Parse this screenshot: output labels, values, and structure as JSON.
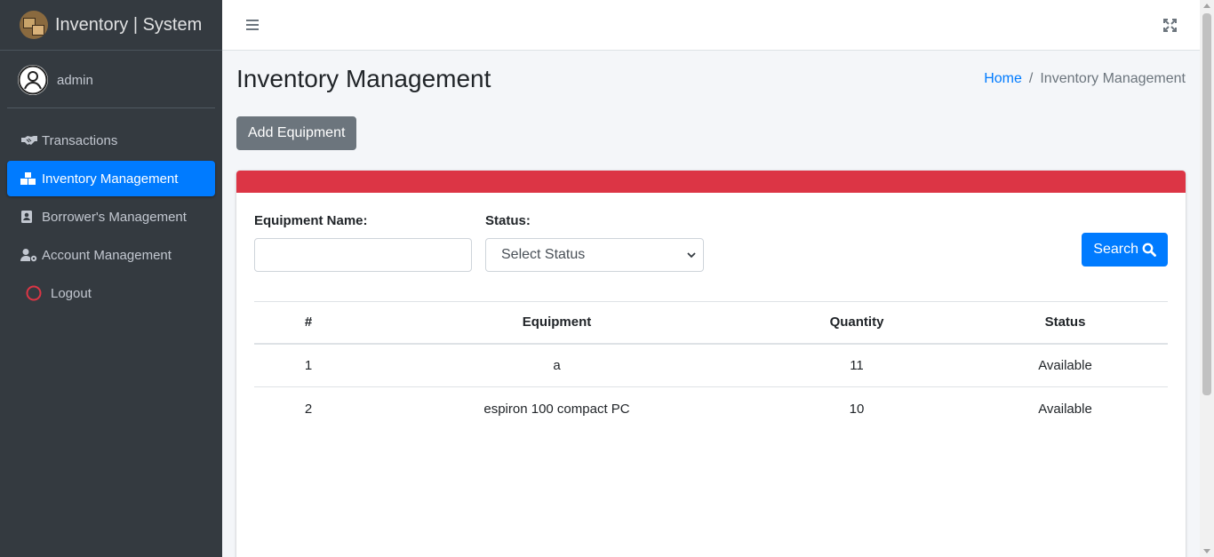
{
  "brand": {
    "title": "Inventory | System"
  },
  "user": {
    "name": "admin"
  },
  "sidebar": {
    "items": [
      {
        "label": "Transactions",
        "icon": "handshake-icon"
      },
      {
        "label": "Inventory Management",
        "icon": "boxes-icon",
        "active": true
      },
      {
        "label": "Borrower's Management",
        "icon": "address-book-icon"
      },
      {
        "label": "Account Management",
        "icon": "user-cog-icon"
      },
      {
        "label": "Logout",
        "icon": "logout-circle-icon"
      }
    ]
  },
  "page": {
    "title": "Inventory Management",
    "breadcrumb": {
      "home": "Home",
      "current": "Inventory Management"
    },
    "add_button": "Add Equipment"
  },
  "filters": {
    "name_label": "Equipment Name:",
    "name_value": "",
    "status_label": "Status:",
    "status_selected": "Select Status",
    "search_button": "Search"
  },
  "table": {
    "headers": [
      "#",
      "Equipment",
      "Quantity",
      "Status"
    ],
    "rows": [
      {
        "num": "1",
        "equipment": "a",
        "quantity": "11",
        "status": "Available"
      },
      {
        "num": "2",
        "equipment": "espiron 100 compact PC",
        "quantity": "10",
        "status": "Available"
      }
    ]
  },
  "colors": {
    "sidebar_bg": "#343a40",
    "primary": "#007bff",
    "secondary": "#6c757d",
    "danger": "#dc3545"
  }
}
